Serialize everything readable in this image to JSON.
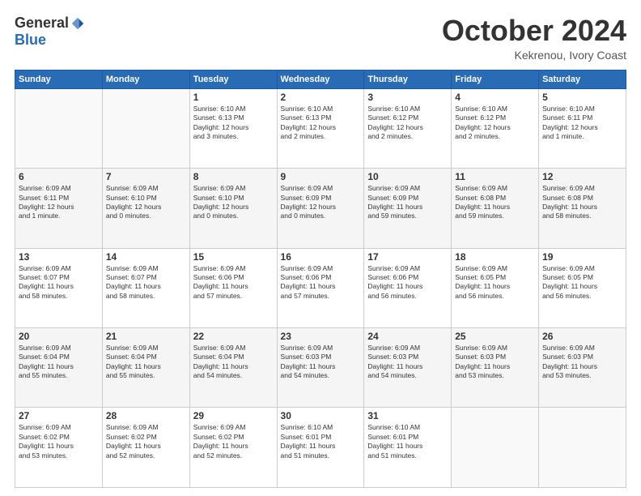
{
  "logo": {
    "general": "General",
    "blue": "Blue"
  },
  "header": {
    "month": "October 2024",
    "location": "Kekrenou, Ivory Coast"
  },
  "days_of_week": [
    "Sunday",
    "Monday",
    "Tuesday",
    "Wednesday",
    "Thursday",
    "Friday",
    "Saturday"
  ],
  "weeks": [
    [
      {
        "day": "",
        "info": ""
      },
      {
        "day": "",
        "info": ""
      },
      {
        "day": "1",
        "info": "Sunrise: 6:10 AM\nSunset: 6:13 PM\nDaylight: 12 hours\nand 3 minutes."
      },
      {
        "day": "2",
        "info": "Sunrise: 6:10 AM\nSunset: 6:13 PM\nDaylight: 12 hours\nand 2 minutes."
      },
      {
        "day": "3",
        "info": "Sunrise: 6:10 AM\nSunset: 6:12 PM\nDaylight: 12 hours\nand 2 minutes."
      },
      {
        "day": "4",
        "info": "Sunrise: 6:10 AM\nSunset: 6:12 PM\nDaylight: 12 hours\nand 2 minutes."
      },
      {
        "day": "5",
        "info": "Sunrise: 6:10 AM\nSunset: 6:11 PM\nDaylight: 12 hours\nand 1 minute."
      }
    ],
    [
      {
        "day": "6",
        "info": "Sunrise: 6:09 AM\nSunset: 6:11 PM\nDaylight: 12 hours\nand 1 minute."
      },
      {
        "day": "7",
        "info": "Sunrise: 6:09 AM\nSunset: 6:10 PM\nDaylight: 12 hours\nand 0 minutes."
      },
      {
        "day": "8",
        "info": "Sunrise: 6:09 AM\nSunset: 6:10 PM\nDaylight: 12 hours\nand 0 minutes."
      },
      {
        "day": "9",
        "info": "Sunrise: 6:09 AM\nSunset: 6:09 PM\nDaylight: 12 hours\nand 0 minutes."
      },
      {
        "day": "10",
        "info": "Sunrise: 6:09 AM\nSunset: 6:09 PM\nDaylight: 11 hours\nand 59 minutes."
      },
      {
        "day": "11",
        "info": "Sunrise: 6:09 AM\nSunset: 6:08 PM\nDaylight: 11 hours\nand 59 minutes."
      },
      {
        "day": "12",
        "info": "Sunrise: 6:09 AM\nSunset: 6:08 PM\nDaylight: 11 hours\nand 58 minutes."
      }
    ],
    [
      {
        "day": "13",
        "info": "Sunrise: 6:09 AM\nSunset: 6:07 PM\nDaylight: 11 hours\nand 58 minutes."
      },
      {
        "day": "14",
        "info": "Sunrise: 6:09 AM\nSunset: 6:07 PM\nDaylight: 11 hours\nand 58 minutes."
      },
      {
        "day": "15",
        "info": "Sunrise: 6:09 AM\nSunset: 6:06 PM\nDaylight: 11 hours\nand 57 minutes."
      },
      {
        "day": "16",
        "info": "Sunrise: 6:09 AM\nSunset: 6:06 PM\nDaylight: 11 hours\nand 57 minutes."
      },
      {
        "day": "17",
        "info": "Sunrise: 6:09 AM\nSunset: 6:06 PM\nDaylight: 11 hours\nand 56 minutes."
      },
      {
        "day": "18",
        "info": "Sunrise: 6:09 AM\nSunset: 6:05 PM\nDaylight: 11 hours\nand 56 minutes."
      },
      {
        "day": "19",
        "info": "Sunrise: 6:09 AM\nSunset: 6:05 PM\nDaylight: 11 hours\nand 56 minutes."
      }
    ],
    [
      {
        "day": "20",
        "info": "Sunrise: 6:09 AM\nSunset: 6:04 PM\nDaylight: 11 hours\nand 55 minutes."
      },
      {
        "day": "21",
        "info": "Sunrise: 6:09 AM\nSunset: 6:04 PM\nDaylight: 11 hours\nand 55 minutes."
      },
      {
        "day": "22",
        "info": "Sunrise: 6:09 AM\nSunset: 6:04 PM\nDaylight: 11 hours\nand 54 minutes."
      },
      {
        "day": "23",
        "info": "Sunrise: 6:09 AM\nSunset: 6:03 PM\nDaylight: 11 hours\nand 54 minutes."
      },
      {
        "day": "24",
        "info": "Sunrise: 6:09 AM\nSunset: 6:03 PM\nDaylight: 11 hours\nand 54 minutes."
      },
      {
        "day": "25",
        "info": "Sunrise: 6:09 AM\nSunset: 6:03 PM\nDaylight: 11 hours\nand 53 minutes."
      },
      {
        "day": "26",
        "info": "Sunrise: 6:09 AM\nSunset: 6:03 PM\nDaylight: 11 hours\nand 53 minutes."
      }
    ],
    [
      {
        "day": "27",
        "info": "Sunrise: 6:09 AM\nSunset: 6:02 PM\nDaylight: 11 hours\nand 53 minutes."
      },
      {
        "day": "28",
        "info": "Sunrise: 6:09 AM\nSunset: 6:02 PM\nDaylight: 11 hours\nand 52 minutes."
      },
      {
        "day": "29",
        "info": "Sunrise: 6:09 AM\nSunset: 6:02 PM\nDaylight: 11 hours\nand 52 minutes."
      },
      {
        "day": "30",
        "info": "Sunrise: 6:10 AM\nSunset: 6:01 PM\nDaylight: 11 hours\nand 51 minutes."
      },
      {
        "day": "31",
        "info": "Sunrise: 6:10 AM\nSunset: 6:01 PM\nDaylight: 11 hours\nand 51 minutes."
      },
      {
        "day": "",
        "info": ""
      },
      {
        "day": "",
        "info": ""
      }
    ]
  ]
}
